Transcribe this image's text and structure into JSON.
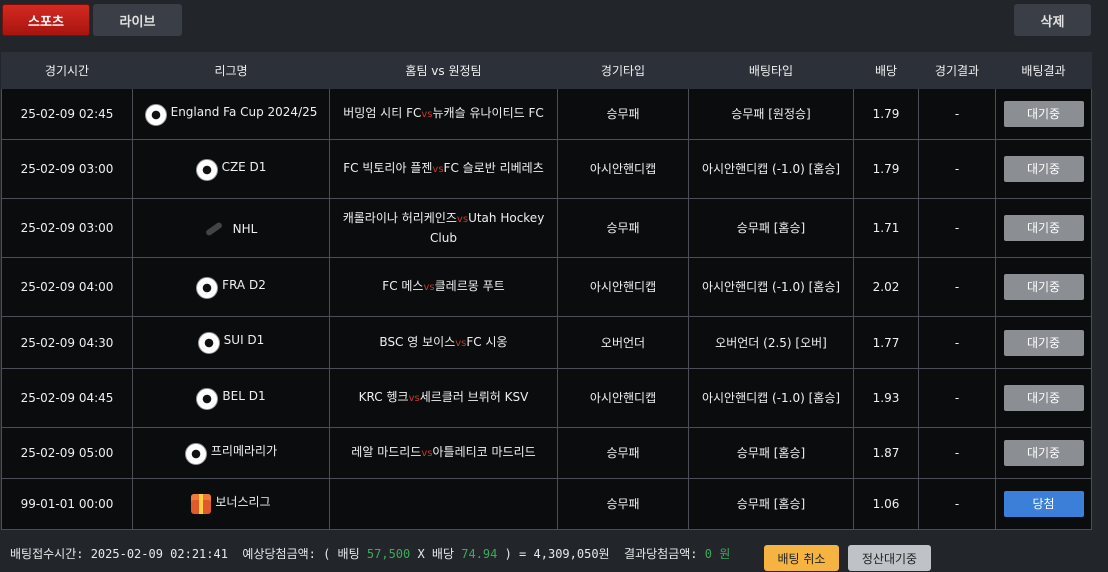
{
  "tabs": {
    "sports": "스포츠",
    "live": "라이브",
    "delete": "삭제"
  },
  "headers": [
    "경기시간",
    "리그명",
    "홈팀 vs 원정팀",
    "경기타입",
    "배팅타입",
    "배당",
    "경기결과",
    "배팅결과"
  ],
  "vs_label": "vs",
  "rows": [
    {
      "time": "25-02-09 02:45",
      "icon": "soccer-ball-icon",
      "league": "England Fa Cup 2024/25",
      "home": "버밍엄 시티 FC",
      "away": "뉴캐슬 유나이티드 FC",
      "type": "승무패",
      "bet_type": "승무패 [원정승]",
      "odds": "1.79",
      "result": "-",
      "status": "대기중"
    },
    {
      "time": "25-02-09 03:00",
      "icon": "soccer-ball-icon",
      "league": "CZE D1",
      "home": "FC 빅토리아 플젠",
      "away": "FC 슬로반 리베레츠",
      "type": "아시안핸디캡",
      "bet_type": "아시안핸디캡 (-1.0) [홈승]",
      "odds": "1.79",
      "result": "-",
      "status": "대기중"
    },
    {
      "time": "25-02-09 03:00",
      "icon": "hockey-puck-icon",
      "league": "NHL",
      "home": "캐롤라이나 허리케인즈",
      "away": "Utah Hockey Club",
      "type": "승무패",
      "bet_type": "승무패 [홈승]",
      "odds": "1.71",
      "result": "-",
      "status": "대기중"
    },
    {
      "time": "25-02-09 04:00",
      "icon": "soccer-ball-icon",
      "league": "FRA D2",
      "home": "FC 메스",
      "away": "클레르몽 푸트",
      "type": "아시안핸디캡",
      "bet_type": "아시안핸디캡 (-1.0) [홈승]",
      "odds": "2.02",
      "result": "-",
      "status": "대기중"
    },
    {
      "time": "25-02-09 04:30",
      "icon": "soccer-ball-icon",
      "league": "SUI D1",
      "home": "BSC 영 보이스",
      "away": "FC 시옹",
      "type": "오버언더",
      "bet_type": "오버언더 (2.5) [오버]",
      "odds": "1.77",
      "result": "-",
      "status": "대기중"
    },
    {
      "time": "25-02-09 04:45",
      "icon": "soccer-ball-icon",
      "league": "BEL D1",
      "home": "KRC 헹크",
      "away": "세르클러 브뤼허 KSV",
      "type": "아시안핸디캡",
      "bet_type": "아시안핸디캡 (-1.0) [홈승]",
      "odds": "1.93",
      "result": "-",
      "status": "대기중"
    },
    {
      "time": "25-02-09 05:00",
      "icon": "soccer-ball-icon",
      "league": "프리메라리가",
      "home": "레알 마드리드",
      "away": "아틀레티코 마드리드",
      "type": "승무패",
      "bet_type": "승무패 [홈승]",
      "odds": "1.87",
      "result": "-",
      "status": "대기중"
    },
    {
      "time": "99-01-01 00:00",
      "icon": "gift-icon",
      "league": "보너스리그",
      "home": "",
      "away": "",
      "type": "승무패",
      "bet_type": "승무패 [홈승]",
      "odds": "1.06",
      "result": "-",
      "status": "당첨"
    }
  ],
  "footer": {
    "bet_time_label": "배팅접수시간: 2025-02-09 02:21:41",
    "expected_label": "예상당첨금액: ( 배팅",
    "bet_amount": "57,500",
    "x_odds_label": "X 배당",
    "total_odds": "74.94",
    "equals_label": ") =",
    "expected_amount": "4,309,050원",
    "result_label": "결과당첨금액:",
    "result_amount": "0 원",
    "cancel_button": "배팅 취소",
    "pending_button": "정산대기중"
  }
}
